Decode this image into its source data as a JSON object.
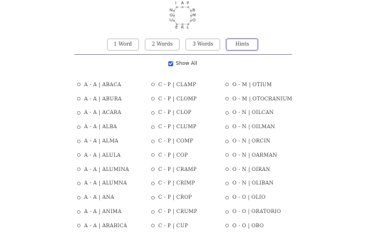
{
  "logo": {
    "letters": [
      "I",
      "A",
      "P",
      "N",
      "B",
      "O",
      "M",
      "U",
      "O",
      "E",
      "R",
      "L"
    ]
  },
  "tabs": [
    {
      "label": "1 Word",
      "active": false
    },
    {
      "label": "2 Words",
      "active": false
    },
    {
      "label": "3 Words",
      "active": false
    },
    {
      "label": "Hints",
      "active": true
    }
  ],
  "show_all": {
    "label": "Show All",
    "checked": true
  },
  "columns": [
    [
      "A - A | ABACA",
      "A - A | ABURA",
      "A - A | ACARA",
      "A - A | ALBA",
      "A - A | ALMA",
      "A - A | ALULA",
      "A - A | ALUMINA",
      "A - A | ALUMNA",
      "A - A | ANA",
      "A - A | ANIMA",
      "A - A | ARABICA"
    ],
    [
      "C - P | CLAMP",
      "C - P | CLOMP",
      "C - P | CLOP",
      "C - P | CLUMP",
      "C - P | COMP",
      "C - P | COP",
      "C - P | CRAMP",
      "C - P | CRIMP",
      "C - P | CROP",
      "C - P | CRUMP",
      "C - P | CUP"
    ],
    [
      "O - M | OTIUM",
      "O - M | OTOCRANIUM",
      "O - N | OILCAN",
      "O - N | OILMAN",
      "O - N | ORCIN",
      "O - N | OARMAN",
      "O - N | OIRAN",
      "O - N | OLIBAN",
      "O - O | OLIO",
      "O - O | ORATORIO",
      "O - O | OBO"
    ]
  ]
}
